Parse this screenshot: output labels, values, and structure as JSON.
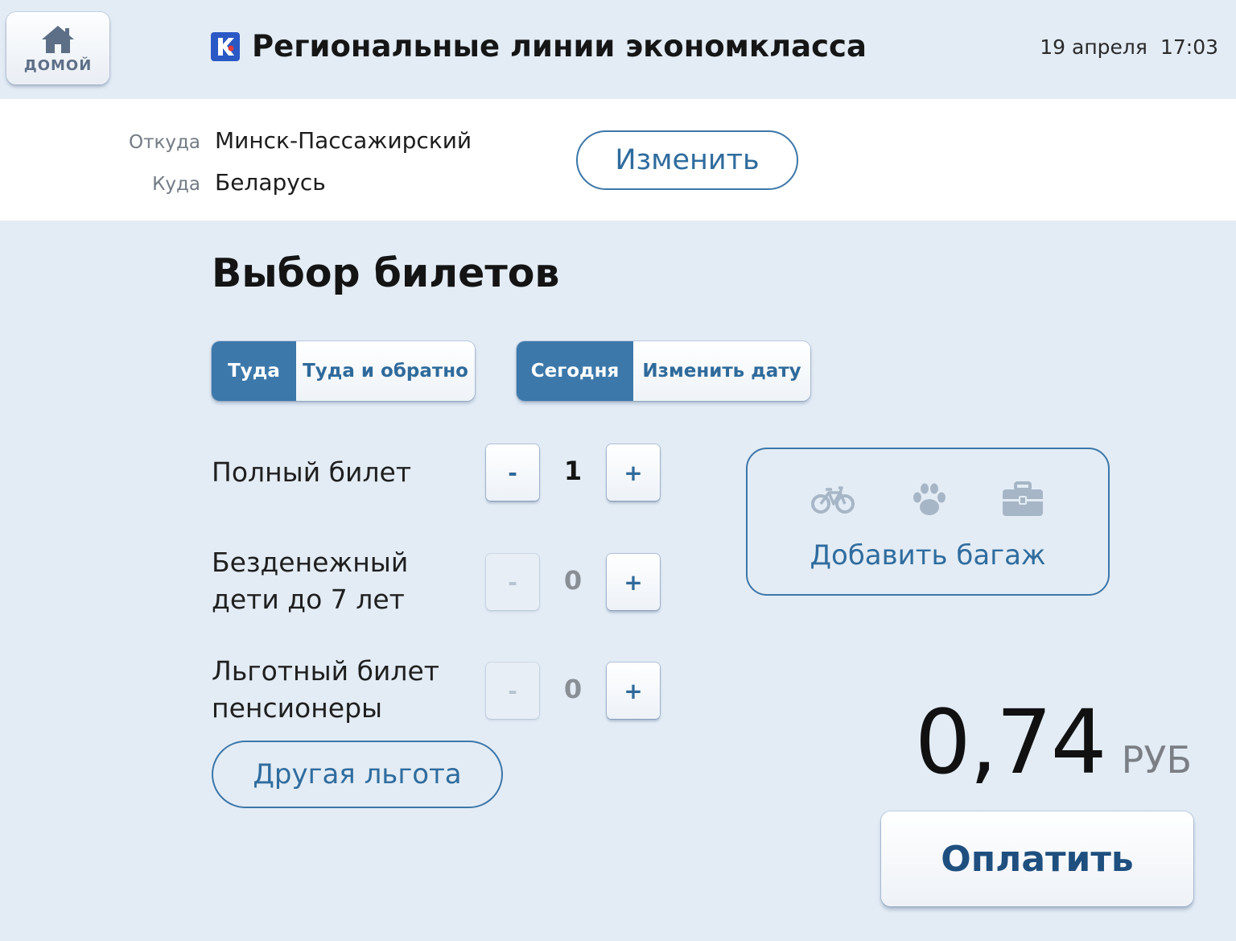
{
  "header": {
    "home_label": "ДОМОЙ",
    "home_icon": "home-icon",
    "logo_icon": "railway-logo-icon",
    "title": "Региональные линии экономкласса",
    "date": "19 апреля",
    "time": "17:03"
  },
  "route": {
    "from_label": "Откуда",
    "from_value": "Минск-Пассажирский",
    "to_label": "Куда",
    "to_value": "Беларусь",
    "change_label": "Изменить"
  },
  "section_title": "Выбор билетов",
  "direction": {
    "options": [
      "Туда",
      "Туда и обратно"
    ],
    "selected": "Туда"
  },
  "date_choice": {
    "options": [
      "Сегодня",
      "Изменить дату"
    ],
    "selected": "Сегодня"
  },
  "tickets": [
    {
      "line1": "Полный билет",
      "line2": "",
      "minus": "-",
      "count": "1",
      "plus": "+"
    },
    {
      "line1": "Безденежный",
      "line2": "дети до 7 лет",
      "minus": "-",
      "count": "0",
      "plus": "+"
    },
    {
      "line1": "Льготный билет",
      "line2": "пенсионеры",
      "minus": "-",
      "count": "0",
      "plus": "+"
    }
  ],
  "other_benefit_label": "Другая льгота",
  "luggage": {
    "label": "Добавить багаж",
    "icons": [
      "bicycle-icon",
      "paw-icon",
      "suitcase-icon"
    ]
  },
  "price": {
    "amount": "0,74",
    "currency": "РУБ"
  },
  "pay_label": "Оплатить",
  "colors": {
    "background": "#e3ecf5",
    "accent": "#3c78aa",
    "accent_text": "#2f6c9e",
    "icon_muted": "#a7b6c6"
  }
}
